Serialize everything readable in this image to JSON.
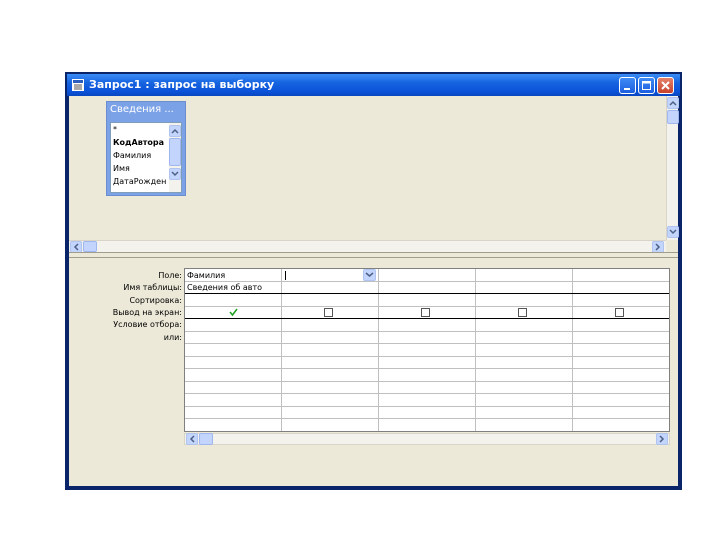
{
  "window": {
    "title": "Запрос1 : запрос на выборку",
    "buttons": [
      "minimize",
      "maximize",
      "close"
    ]
  },
  "table_box": {
    "title": "Сведения ...",
    "fields": [
      "*",
      "КодАвтора",
      "Фамилия",
      "Имя",
      "ДатаРожден"
    ]
  },
  "grid": {
    "row_labels": [
      "Поле:",
      "Имя таблицы:",
      "Сортировка:",
      "Вывод на экран:",
      "Условие отбора:",
      "или:"
    ],
    "columns": [
      {
        "field": "Фамилия",
        "table": "Сведения об авто",
        "show": true
      },
      {
        "field": "",
        "table": "",
        "show": false
      },
      {
        "field": "",
        "table": "",
        "show": false
      },
      {
        "field": "",
        "table": "",
        "show": false
      },
      {
        "field": "",
        "table": "",
        "show": false
      }
    ]
  },
  "icons": [
    "query-icon",
    "minimize-icon",
    "maximize-icon",
    "close-icon",
    "checkmark-icon",
    "chevron-up-icon",
    "chevron-down-icon",
    "chevron-left-icon",
    "chevron-right-icon",
    "dropdown-arrow-icon"
  ],
  "colors": {
    "titlebar": "#0a52d8",
    "frame": "#0a246a",
    "client": "#ece9d8",
    "table_header": "#7ba2e7",
    "check": "#1e9e1e"
  }
}
